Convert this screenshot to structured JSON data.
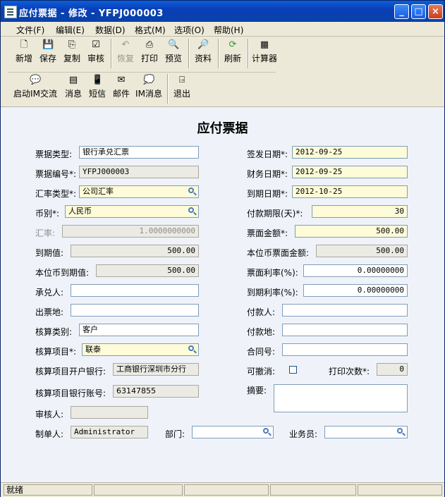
{
  "window": {
    "title": "应付票据 - 修改 - YFPJ000003",
    "controls": {
      "minimize": "_",
      "maximize": "□",
      "close": "×"
    }
  },
  "menu": [
    {
      "label": "文件(F)"
    },
    {
      "label": "编辑(E)"
    },
    {
      "label": "数据(D)"
    },
    {
      "label": "格式(M)"
    },
    {
      "label": "选项(O)"
    },
    {
      "label": "帮助(H)"
    }
  ],
  "toolbar1": {
    "new": "新增",
    "save": "保存",
    "copy": "复制",
    "audit": "审核",
    "restore": "恢复",
    "print": "打印",
    "preview": "预览",
    "info": "资料",
    "refresh": "刷新",
    "calculator": "计算器"
  },
  "toolbar2": {
    "start_im": "启动IM交流",
    "message": "消息",
    "sms": "短信",
    "mail": "邮件",
    "im_message": "IM消息",
    "exit": "退出"
  },
  "form": {
    "title": "应付票据",
    "bill_type_label": "票据类型:",
    "bill_type": "银行承兑汇票",
    "bill_no_label": "票据编号*:",
    "bill_no": "YFPJ000003",
    "rate_type_label": "汇率类型*:",
    "rate_type": "公司汇率",
    "currency_label": "币别*:",
    "currency": "人民币",
    "exchange_rate_label": "汇率:",
    "exchange_rate": "1.0000000000",
    "due_value_label": "到期值:",
    "due_value": "500.00",
    "local_due_value_label": "本位币到期值:",
    "local_due_value": "500.00",
    "acceptor_label": "承兑人:",
    "acceptor": "",
    "issue_place_label": "出票地:",
    "issue_place": "",
    "acct_category_label": "核算类别:",
    "acct_category": "客户",
    "acct_item_label": "核算项目*:",
    "acct_item": "联泰",
    "acct_bank_label": "核算项目开户银行:",
    "acct_bank": "工商银行深圳市分行",
    "acct_account_label": "核算项目银行账号:",
    "acct_account": "63147855",
    "auditor_label": "审核人:",
    "auditor": "",
    "creator_label": "制单人:",
    "creator": "Administrator",
    "dept_label": "部门:",
    "dept": "",
    "salesman_label": "业务员:",
    "salesman": "",
    "issue_date_label": "签发日期*:",
    "issue_date": "2012-09-25",
    "fin_date_label": "财务日期*:",
    "fin_date": "2012-09-25",
    "due_date_label": "到期日期*:",
    "due_date": "2012-10-25",
    "pay_term_label": "付款期限(天)*:",
    "pay_term": "30",
    "face_amount_label": "票面金额*:",
    "face_amount": "500.00",
    "local_face_amount_label": "本位币票面金额:",
    "local_face_amount": "500.00",
    "face_rate_label": "票面利率(%):",
    "face_rate": "0.00000000",
    "due_rate_label": "到期利率(%):",
    "due_rate": "0.00000000",
    "payer_label": "付款人:",
    "payer": "",
    "pay_place_label": "付款地:",
    "pay_place": "",
    "contract_label": "合同号:",
    "contract": "",
    "revocable_label": "可撤消:",
    "print_count_label": "打印次数*:",
    "print_count": "0",
    "summary_label": "摘要:",
    "summary": ""
  },
  "status": {
    "text": "就绪"
  }
}
